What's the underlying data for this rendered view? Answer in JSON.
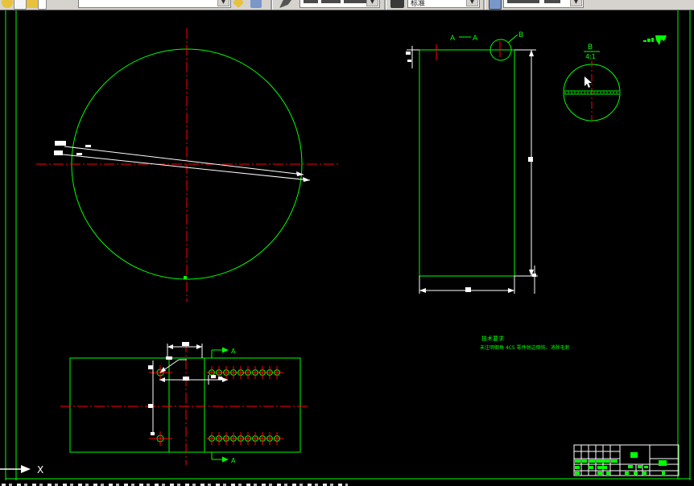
{
  "toolbar": {
    "style_combo_value": "标准"
  },
  "drawing": {
    "section_title_left": "A",
    "section_title_right": "A",
    "detail_leader_label": "B",
    "detail_title_label": "B",
    "detail_scale": "4:1",
    "cut_arrow_top_label": "A",
    "cut_arrow_bottom_label": "A",
    "ucs_x_label": "X",
    "notes": {
      "title": "技术要求",
      "body": "未注明倒角 4C5 零件锐边倒钝、消除毛刺"
    }
  },
  "colors": {
    "draw_green": "#00ff00",
    "centerline_red": "#ff0000",
    "dim_white": "#ffffff",
    "canvas_black": "#000000",
    "toolbar_gray": "#d6d3ce"
  }
}
